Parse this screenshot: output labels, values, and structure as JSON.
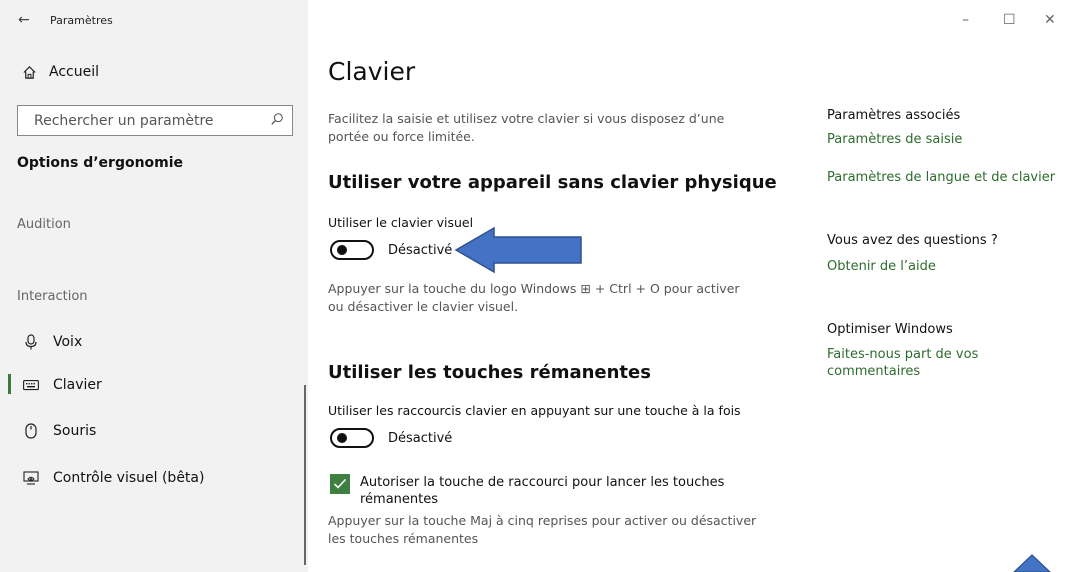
{
  "window": {
    "title": "Paramètres",
    "back_icon": "←",
    "minimize_icon": "–",
    "maximize_icon": "☐",
    "close_icon": "✕"
  },
  "sidebar": {
    "home_label": "Accueil",
    "search_placeholder": "Rechercher un paramètre",
    "section_heading": "Options d’ergonomie",
    "groups": [
      "Audition",
      "Interaction"
    ],
    "items": [
      {
        "label": "Voix",
        "icon": "microphone-icon"
      },
      {
        "label": "Clavier",
        "icon": "keyboard-icon",
        "active": true
      },
      {
        "label": "Souris",
        "icon": "mouse-icon"
      },
      {
        "label": "Contrôle visuel (bêta)",
        "icon": "eye-control-icon"
      }
    ],
    "accent_color": "#3a7a3a"
  },
  "main": {
    "title": "Clavier",
    "intro": "Facilitez la saisie et utilisez votre clavier si vous disposez d’une portée ou force limitée.",
    "sections": [
      {
        "title": "Utiliser votre appareil sans clavier physique",
        "setting_label": "Utiliser le clavier visuel",
        "toggle_state": "Désactivé",
        "description": "Appuyer sur la touche du logo Windows ⊞ + Ctrl + O pour activer ou désactiver le clavier visuel."
      },
      {
        "title": "Utiliser les touches rémanentes",
        "setting_label": "Utiliser les raccourcis clavier en appuyant sur une touche à la fois",
        "toggle_state": "Désactivé",
        "checkbox_label": "Autoriser la touche de raccourci pour lancer les touches rémanentes",
        "checkbox_checked": true,
        "description": "Appuyer sur la touche Maj à cinq reprises pour activer ou désactiver les touches rémanentes"
      }
    ]
  },
  "related": {
    "heading1": "Paramètres associés",
    "link1": "Paramètres de saisie",
    "link2": "Paramètres de langue et de clavier",
    "heading2": "Vous avez des questions ?",
    "link3": "Obtenir de l’aide",
    "heading3": "Optimiser Windows",
    "link4": "Faites-nous part de vos commentaires",
    "link_color": "#2e6b2e"
  },
  "annotation": {
    "arrow_color": "#4472c4"
  }
}
